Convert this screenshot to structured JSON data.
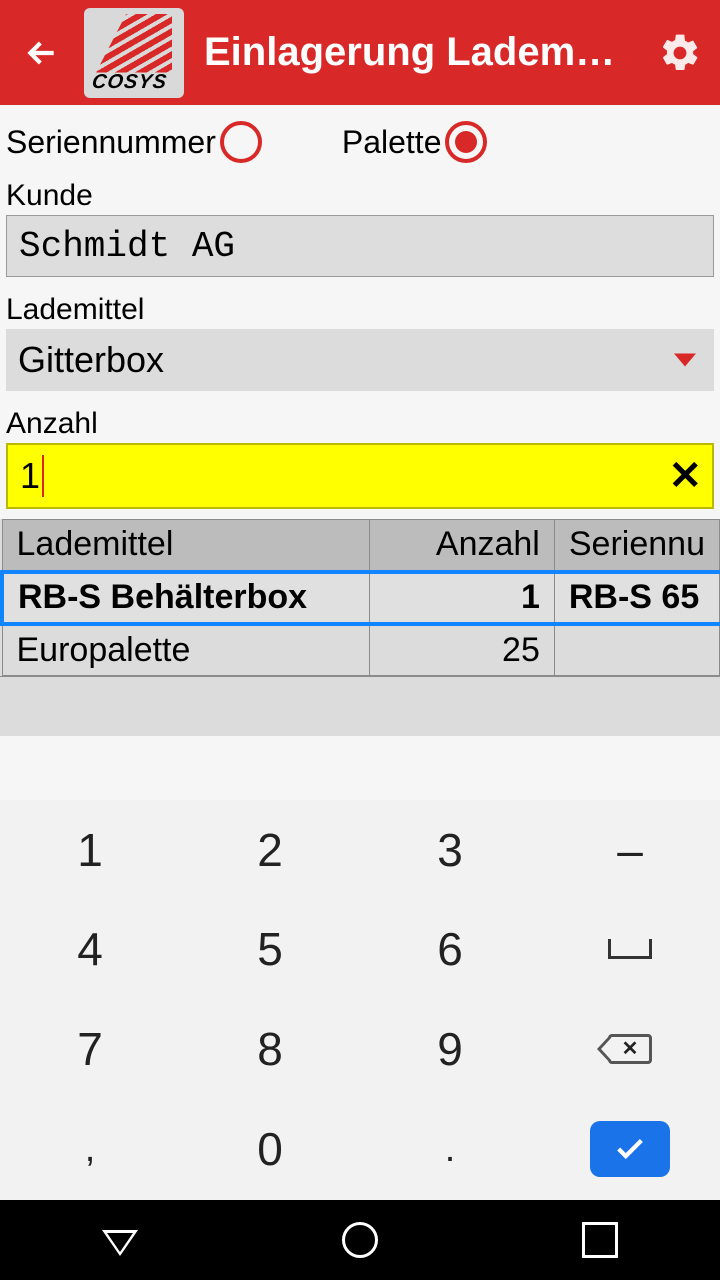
{
  "header": {
    "logo_text": "COSYS",
    "title": "Einlagerung Ladem…"
  },
  "radio": {
    "serial_label": "Seriennummer",
    "serial_selected": false,
    "palette_label": "Palette",
    "palette_selected": true
  },
  "fields": {
    "kunde_label": "Kunde",
    "kunde_value": "Schmidt AG",
    "lademittel_label": "Lademittel",
    "lademittel_value": "Gitterbox",
    "anzahl_label": "Anzahl",
    "anzahl_value": "1"
  },
  "table": {
    "headers": [
      "Lademittel",
      "Anzahl",
      "Seriennu"
    ],
    "rows": [
      {
        "lademittel": "RB-S Behälterbox",
        "anzahl": "1",
        "serien": "RB-S 65",
        "selected": true
      },
      {
        "lademittel": "Europalette",
        "anzahl": "25",
        "serien": "",
        "selected": false
      }
    ]
  },
  "keypad": {
    "k1": "1",
    "k2": "2",
    "k3": "3",
    "kdash": "–",
    "k4": "4",
    "k5": "5",
    "k6": "6",
    "k7": "7",
    "k8": "8",
    "k9": "9",
    "kcomma": ",",
    "k0": "0",
    "kdot": "."
  }
}
